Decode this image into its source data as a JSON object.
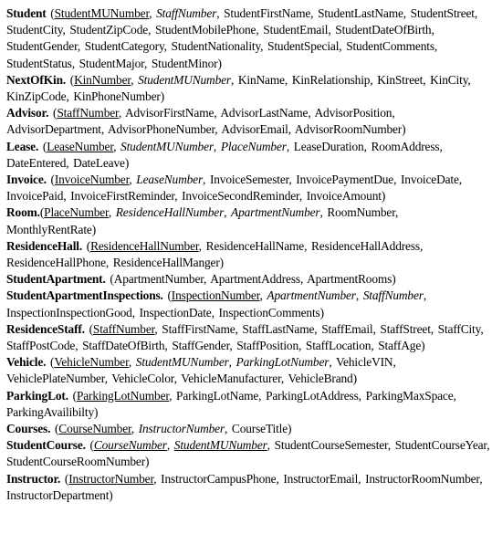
{
  "relations": [
    {
      "name": "Student",
      "sep": " (",
      "attributes": [
        {
          "text": "StudentMUNumber",
          "pk": true
        },
        {
          "text": "StaffNumber",
          "fk": true
        },
        {
          "text": "StudentFirstName"
        },
        {
          "text": "StudentLastName"
        },
        {
          "text": "StudentStreet"
        },
        {
          "text": "StudentCity"
        },
        {
          "text": "StudentZipCode"
        },
        {
          "text": "StudentMobilePhone"
        },
        {
          "text": "StudentEmail"
        },
        {
          "text": "StudentDateOfBirth"
        },
        {
          "text": "StudentGender"
        },
        {
          "text": "StudentCategory"
        },
        {
          "text": "StudentNationality"
        },
        {
          "text": "StudentSpecial"
        },
        {
          "text": "StudentComments"
        },
        {
          "text": "StudentStatus"
        },
        {
          "text": "StudentMajor"
        },
        {
          "text": "StudentMinor"
        }
      ]
    },
    {
      "name": "NextOfKin.",
      "sep": " (",
      "attributes": [
        {
          "text": "KinNumber",
          "pk": true
        },
        {
          "text": "StudentMUNumber",
          "fk": true
        },
        {
          "text": "KinName"
        },
        {
          "text": "KinRelationship"
        },
        {
          "text": "KinStreet"
        },
        {
          "text": "KinCity"
        },
        {
          "text": "KinZipCode"
        },
        {
          "text": "KinPhoneNumber"
        }
      ]
    },
    {
      "name": "Advisor.",
      "sep": " (",
      "attributes": [
        {
          "text": "StaffNumber",
          "pk": true
        },
        {
          "text": "AdvisorFirstName"
        },
        {
          "text": "AdvisorLastName"
        },
        {
          "text": "AdvisorPosition"
        },
        {
          "text": "AdvisorDepartment"
        },
        {
          "text": "AdvisorPhoneNumber"
        },
        {
          "text": "AdvisorEmail"
        },
        {
          "text": "AdvisorRoomNumber"
        }
      ]
    },
    {
      "name": "Lease.",
      "sep": " (",
      "attributes": [
        {
          "text": "LeaseNumber",
          "pk": true
        },
        {
          "text": "StudentMUNumber",
          "fk": true
        },
        {
          "text": "PlaceNumber",
          "fk": true
        },
        {
          "text": "LeaseDuration"
        },
        {
          "text": "RoomAddress"
        },
        {
          "text": "DateEntered"
        },
        {
          "text": "DateLeave"
        }
      ]
    },
    {
      "name": "Invoice.",
      "sep": " (",
      "attributes": [
        {
          "text": "InvoiceNumber",
          "pk": true
        },
        {
          "text": "LeaseNumber",
          "fk": true
        },
        {
          "text": "InvoiceSemester"
        },
        {
          "text": "InvoicePaymentDue"
        },
        {
          "text": "InvoiceDate"
        },
        {
          "text": "InvoicePaid"
        },
        {
          "text": "InvoiceFirstReminder"
        },
        {
          "text": "InvoiceSecondReminder"
        },
        {
          "text": "InvoiceAmount"
        }
      ]
    },
    {
      "name": "Room.",
      "sep": "(",
      "attributes": [
        {
          "text": "PlaceNumber",
          "pk": true
        },
        {
          "text": "ResidenceHallNumber",
          "fk": true
        },
        {
          "text": "ApartmentNumber",
          "fk": true
        },
        {
          "text": "RoomNumber"
        },
        {
          "text": "MonthlyRentRate"
        }
      ]
    },
    {
      "name": "ResidenceHall.",
      "sep": " (",
      "attributes": [
        {
          "text": "ResidenceHallNumber",
          "pk": true
        },
        {
          "text": "ResidenceHallName"
        },
        {
          "text": "ResidenceHallAddress"
        },
        {
          "text": "ResidenceHallPhone"
        },
        {
          "text": "ResidenceHallManger"
        }
      ]
    },
    {
      "name": "StudentApartment.",
      "sep": " (",
      "attributes": [
        {
          "text": "ApartmentNumber"
        },
        {
          "text": "ApartmentAddress"
        },
        {
          "text": "ApartmentRooms"
        }
      ]
    },
    {
      "name": "StudentApartmentInspections.",
      "sep": " (",
      "attributes": [
        {
          "text": "InspectionNumber",
          "pk": true
        },
        {
          "text": "ApartmentNumber",
          "fk": true
        },
        {
          "text": "StaffNumber",
          "fk": true
        },
        {
          "text": "InspectionInspectionGood"
        },
        {
          "text": "InspectionDate"
        },
        {
          "text": "InspectionComments"
        }
      ]
    },
    {
      "name": "ResidenceStaff.",
      "sep": " (",
      "attributes": [
        {
          "text": "StaffNumber",
          "pk": true
        },
        {
          "text": "StaffFirstName"
        },
        {
          "text": "StaffLastName"
        },
        {
          "text": "StaffEmail"
        },
        {
          "text": "StaffStreet"
        },
        {
          "text": "StaffCity"
        },
        {
          "text": "StaffPostCode"
        },
        {
          "text": "StaffDateOfBirth"
        },
        {
          "text": "StaffGender"
        },
        {
          "text": "StaffPosition"
        },
        {
          "text": "StaffLocation"
        },
        {
          "text": "StaffAge"
        }
      ]
    },
    {
      "name": "Vehicle.",
      "sep": " (",
      "attributes": [
        {
          "text": "VehicleNumber",
          "pk": true
        },
        {
          "text": "StudentMUNumber",
          "fk": true
        },
        {
          "text": "ParkingLotNumber",
          "fk": true
        },
        {
          "text": "VehicleVIN"
        },
        {
          "text": "VehiclePlateNumber"
        },
        {
          "text": "VehicleColor"
        },
        {
          "text": "VehicleManufacturer"
        },
        {
          "text": "VehicleBrand"
        }
      ]
    },
    {
      "name": "ParkingLot.",
      "sep": " (",
      "attributes": [
        {
          "text": "ParkingLotNumber",
          "pk": true
        },
        {
          "text": "ParkingLotName"
        },
        {
          "text": "ParkingLotAddress"
        },
        {
          "text": "ParkingMaxSpace"
        },
        {
          "text": "ParkingAvailibilty"
        }
      ]
    },
    {
      "name": "Courses.",
      "sep": " (",
      "attributes": [
        {
          "text": "CourseNumber",
          "pk": true
        },
        {
          "text": "InstructorNumber",
          "fk": true
        },
        {
          "text": "CourseTitle"
        }
      ]
    },
    {
      "name": "StudentCourse.",
      "sep": " (",
      "attributes": [
        {
          "text": "CourseNumber",
          "pk": true,
          "fk": true
        },
        {
          "text": "StudentMUNumber",
          "pk": true,
          "fk": true
        },
        {
          "text": "StudentCourseSemester"
        },
        {
          "text": "StudentCourseYear"
        },
        {
          "text": "StudentCourseRoomNumber"
        }
      ]
    },
    {
      "name": "Instructor.",
      "sep": " (",
      "attributes": [
        {
          "text": "InstructorNumber",
          "pk": true
        },
        {
          "text": "InstructorCampusPhone"
        },
        {
          "text": "InstructorEmail"
        },
        {
          "text": "InstructorRoomNumber"
        },
        {
          "text": "InstructorDepartment"
        }
      ]
    }
  ]
}
